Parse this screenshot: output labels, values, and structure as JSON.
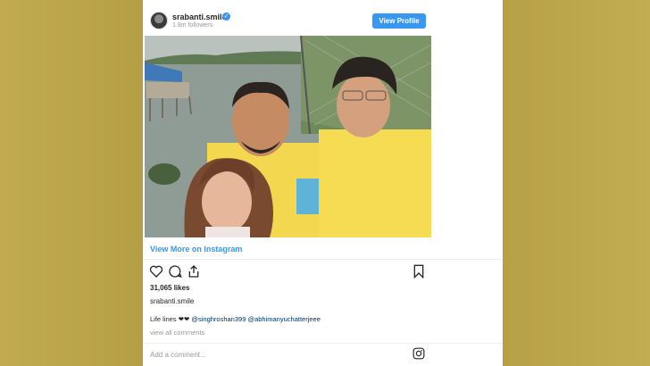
{
  "post": {
    "username": "srabanti.smile",
    "followers": "1.8m followers",
    "view_profile_label": "View Profile",
    "view_more_label": "View More on Instagram",
    "likes": "31,065 likes",
    "author": "srabanti.smile",
    "caption_text": "Life lines",
    "caption_emoji": "❤❤",
    "mention_1": "@singhroshan399",
    "mention_2": "@abhimanyuchatterjeee",
    "view_comments_label": "view all comments",
    "add_comment_placeholder": "Add a comment..."
  },
  "colors": {
    "accent": "#3897f0",
    "background": "#b8a24a"
  },
  "icons": [
    "verified-badge-icon",
    "heart-icon",
    "comment-icon",
    "share-icon",
    "bookmark-icon",
    "instagram-icon"
  ]
}
